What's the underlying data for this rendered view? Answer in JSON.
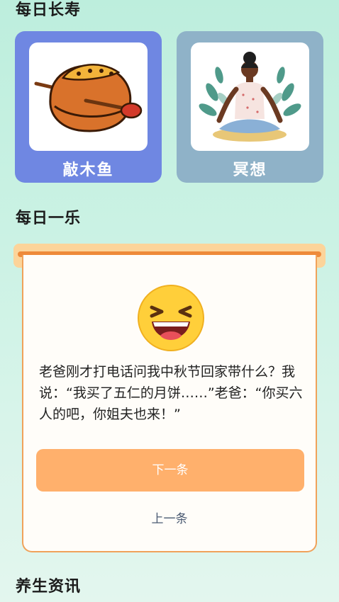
{
  "sections": {
    "longevity": "每日长寿",
    "daily_fun": "每日一乐",
    "health_news": "养生资讯"
  },
  "cards": [
    {
      "label": "敲木鱼",
      "icon": "wooden-fish-icon",
      "bg": "#6f87e2"
    },
    {
      "label": "冥想",
      "icon": "meditation-icon",
      "bg": "#8fb2c8"
    }
  ],
  "joke": {
    "emoji": "laughing-face-icon",
    "text": "老爸刚才打电话问我中秋节回家带什么？我说：“我买了五仁的月饼……”老爸：“你买六人的吧，你姐夫也来！”",
    "next_label": "下一条",
    "prev_label": "上一条"
  },
  "colors": {
    "accent": "#ffb06c",
    "border": "#f0a25a"
  }
}
